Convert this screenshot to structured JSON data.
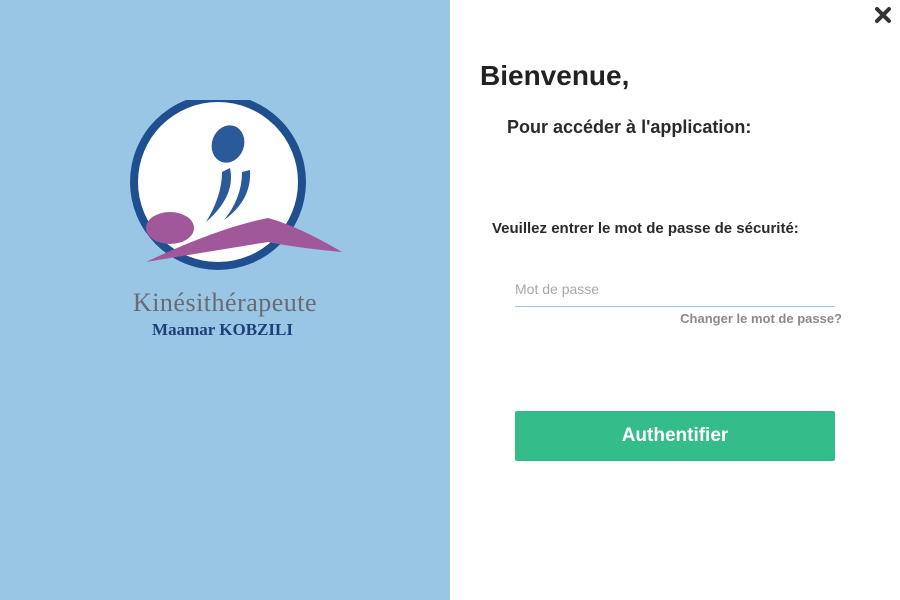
{
  "logo": {
    "title": "Kinésithérapeute",
    "subtitle": "Maamar KOBZILI",
    "colors": {
      "ring": "#1f4f8f",
      "figure": "#2a5a9a",
      "swoosh": "#a0589a",
      "panel_bg": "#9ac6e6"
    }
  },
  "window": {
    "close_icon": "close-icon"
  },
  "login": {
    "heading": "Bienvenue,",
    "subheading": "Pour accéder à l'application:",
    "prompt": "Veuillez entrer le mot de passe de sécurité:",
    "password_placeholder": "Mot de passe",
    "change_password_link": "Changer le mot de passe?",
    "submit_label": "Authentifier",
    "accent_color": "#34bd8a"
  }
}
